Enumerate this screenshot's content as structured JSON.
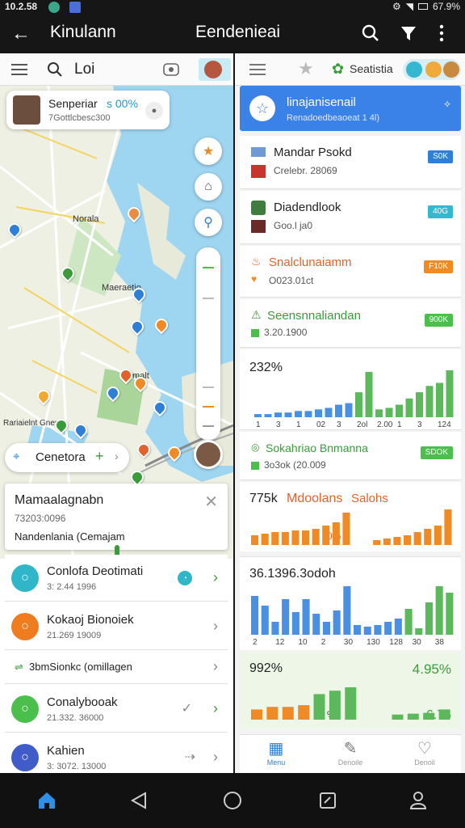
{
  "status_bar": {
    "time": "10.2.58",
    "battery": "67.9%"
  },
  "app_bar": {
    "left_title": "Kinulann",
    "center_title": "Eendenieai"
  },
  "left_panel": {
    "toolbar": {
      "search_text": "Loi"
    },
    "map_card": {
      "title": "Senperiar",
      "percent": "s 00%",
      "subtitle": "7Gottlcbesc300"
    },
    "map_labels": [
      "Norala",
      "Maeraetio",
      "Nomalt",
      "Rariaielnt Gnen"
    ],
    "map_action": {
      "label": "Cenetora"
    },
    "detail_card": {
      "title": "Mamaalagnabn",
      "line1": "73203:0096",
      "line2": "Nandenlania (Cemajam"
    },
    "list": [
      {
        "title": "Conlofa Deotimati",
        "sub": "3: 2.44 1996",
        "color": "#2fb7c9"
      },
      {
        "title": "Kokaoj Bionoiek",
        "sub": "21.269 19009",
        "color": "#ef7c1f"
      },
      {
        "title": "3bmSionkc (omillagen",
        "sub": "",
        "color": "#3a9b3a"
      },
      {
        "title": "Conalybooak",
        "sub": "21.332. 36000",
        "color": "#4bbf4b"
      },
      {
        "title": "Kahien",
        "sub": "3: 3072. 13000",
        "color": "#3f5cc8"
      }
    ]
  },
  "right_panel": {
    "toolbar": {
      "tab_label": "Seatistia"
    },
    "header": {
      "title": "linajanisenail",
      "subtitle": "Renadoedbeaoeat 1 4l)"
    },
    "cards": [
      {
        "title": "Mandar Psokd",
        "sub": "Crelebr. 28069",
        "badge": "S0K",
        "badge_color": "#2f7fd6"
      },
      {
        "title": "Diadendlook",
        "sub": "Goo.l ja0",
        "badge": "40G",
        "badge_color": "#35b7d0"
      },
      {
        "title": "Snalclunaiamm",
        "sub": "O023.01ct",
        "badge": "F10K",
        "badge_color": "#f28a22"
      },
      {
        "title": "Seensnnaliandan",
        "sub": "3.20.1900",
        "badge": "900K",
        "badge_color": "#4bbf4b"
      }
    ],
    "chart1": {
      "value_label": "232%"
    },
    "card5": {
      "title": "Sokahriao Bnmanna",
      "sub": "3o3ok (20.009",
      "badge": "SDOK",
      "badge_color": "#4bbf4b"
    },
    "chart2": {
      "label_a": "775k",
      "label_b": "Mdoolans",
      "label_c": "Salohs",
      "bottom_label": "0%"
    },
    "chart3": {
      "title": "36.1396.3odoh"
    },
    "chart4": {
      "left_label": "992%",
      "right_label": "4.95%",
      "bottom_right": "6.76",
      "mid": "%"
    },
    "bottom_tabs": [
      "Menu",
      "Denoile",
      "Denoil"
    ]
  },
  "nav": {
    "items": [
      "home",
      "back",
      "circle",
      "square",
      "profile"
    ]
  },
  "colors": {
    "blue": "#4a90e2",
    "green": "#5bb85b",
    "orange": "#f08a24",
    "teal": "#35b7d0"
  },
  "chart_data": [
    {
      "type": "bar",
      "title": "232%",
      "categories": [
        "1",
        "2",
        "3",
        "4",
        "5",
        "6",
        "7",
        "8",
        "9",
        "10",
        "11",
        "12",
        "13",
        "14",
        "15",
        "16",
        "17",
        "18",
        "19",
        "20"
      ],
      "series": [
        {
          "values": [
            2,
            2,
            3,
            3,
            4,
            4,
            5,
            6,
            8,
            9,
            16,
            29,
            5,
            6,
            8,
            12,
            16,
            20,
            22,
            30
          ]
        }
      ],
      "x_ticks": [
        "1",
        "3",
        "1",
        "02",
        "3",
        "2ol",
        "2.00",
        "1",
        "3",
        "124"
      ]
    },
    {
      "type": "bar",
      "title": "775k Mdoolans Salohs",
      "categories": [
        "1",
        "2",
        "3",
        "4",
        "5",
        "6",
        "7",
        "8",
        "9",
        "10",
        "11",
        "12",
        "13",
        "14",
        "15",
        "16",
        "17",
        "18",
        "19",
        "20"
      ],
      "series": [
        {
          "values": [
            6,
            7,
            8,
            8,
            9,
            9,
            10,
            12,
            14,
            20,
            0,
            0,
            3,
            4,
            5,
            6,
            8,
            10,
            12,
            22
          ]
        }
      ]
    },
    {
      "type": "bar",
      "title": "36.1396.3odoh",
      "categories": [
        "1",
        "2",
        "3",
        "4",
        "5",
        "6",
        "7",
        "8",
        "9",
        "10",
        "11",
        "12",
        "13",
        "14",
        "15",
        "16",
        "17",
        "18",
        "19",
        "20"
      ],
      "series": [
        {
          "values": [
            24,
            18,
            8,
            22,
            14,
            22,
            13,
            8,
            15,
            30,
            6,
            5,
            6,
            8,
            10,
            16,
            4,
            20,
            30,
            26
          ]
        }
      ],
      "x_ticks": [
        "2",
        "12",
        "10",
        "2",
        "30",
        "130",
        "128",
        "30",
        "38"
      ]
    },
    {
      "type": "bar",
      "title": "992%",
      "categories": [
        "1",
        "2",
        "3",
        "4",
        "5",
        "6",
        "7",
        "8",
        "9",
        "10",
        "11",
        "12",
        "13"
      ],
      "series": [
        {
          "values": [
            12,
            15,
            15,
            17,
            30,
            34,
            38,
            0,
            0,
            6,
            7,
            8,
            12
          ]
        }
      ]
    }
  ]
}
